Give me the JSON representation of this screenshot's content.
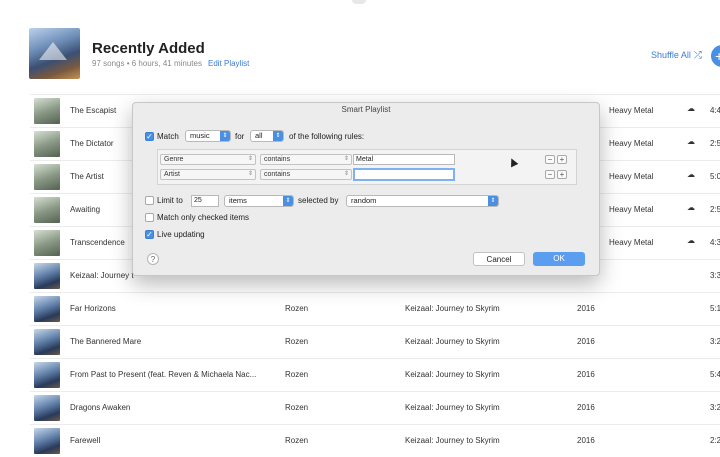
{
  "header": {
    "title": "Recently Added",
    "meta": "97 songs • 6 hours, 41 minutes",
    "edit_playlist": "Edit Playlist",
    "shuffle_all": "Shuffle All",
    "shuffle_icon": "⤮",
    "fab_icon": "+"
  },
  "tracks": [
    {
      "title": "The Escapist",
      "artist": "",
      "album": "",
      "year": "",
      "genre": "Heavy Metal",
      "time": "4:4",
      "cloud": "☁"
    },
    {
      "title": "The Dictator",
      "artist": "",
      "album": "",
      "year": "",
      "genre": "Heavy Metal",
      "time": "2:5",
      "cloud": "☁"
    },
    {
      "title": "The Artist",
      "artist": "",
      "album": "",
      "year": "",
      "genre": "Heavy Metal",
      "time": "5:0",
      "cloud": "☁"
    },
    {
      "title": "Awaiting",
      "artist": "",
      "album": "",
      "year": "",
      "genre": "Heavy Metal",
      "time": "2:5",
      "cloud": "☁"
    },
    {
      "title": "Transcendence",
      "artist": "",
      "album": "",
      "year": "",
      "genre": "Heavy Metal",
      "time": "4:3",
      "cloud": "☁"
    },
    {
      "title": "Keizaal: Journey t",
      "artist": "",
      "album": "",
      "year": "",
      "genre": "",
      "time": "3:3",
      "cloud": ""
    },
    {
      "title": "Far Horizons",
      "artist": "Rozen",
      "album": "Keizaal: Journey to Skyrim",
      "year": "2016",
      "genre": "",
      "time": "5:1",
      "cloud": ""
    },
    {
      "title": "The Bannered Mare",
      "artist": "Rozen",
      "album": "Keizaal: Journey to Skyrim",
      "year": "2016",
      "genre": "",
      "time": "3:2",
      "cloud": ""
    },
    {
      "title": "From Past to Present (feat. Reven & Michaela Nac...",
      "artist": "Rozen",
      "album": "Keizaal: Journey to Skyrim",
      "year": "2016",
      "genre": "",
      "time": "5:4",
      "cloud": ""
    },
    {
      "title": "Dragons Awaken",
      "artist": "Rozen",
      "album": "Keizaal: Journey to Skyrim",
      "year": "2016",
      "genre": "",
      "time": "3:2",
      "cloud": ""
    },
    {
      "title": "Farewell",
      "artist": "Rozen",
      "album": "Keizaal: Journey to Skyrim",
      "year": "2016",
      "genre": "",
      "time": "2:2",
      "cloud": ""
    }
  ],
  "dialog": {
    "title": "Smart Playlist",
    "match_label": "Match",
    "match_value": "music",
    "for_label": "for",
    "for_value": "all",
    "rules_suffix": "of the following rules:",
    "rules": [
      {
        "field": "Genre",
        "operator": "contains",
        "value": ""
      },
      {
        "field": "Artist",
        "operator": "contains",
        "value": ""
      }
    ],
    "rule1_value": "Metal",
    "limit_label": "Limit to",
    "limit_value": "25",
    "limit_unit": "items",
    "selected_by_label": "selected by",
    "selected_by_value": "random",
    "match_checked_label": "Match only checked items",
    "live_updating_label": "Live updating",
    "help": "?",
    "cancel": "Cancel",
    "ok": "OK",
    "match_checked": true,
    "limit_checked": false,
    "match_checked_items_checked": false,
    "live_updating_checked": true
  }
}
